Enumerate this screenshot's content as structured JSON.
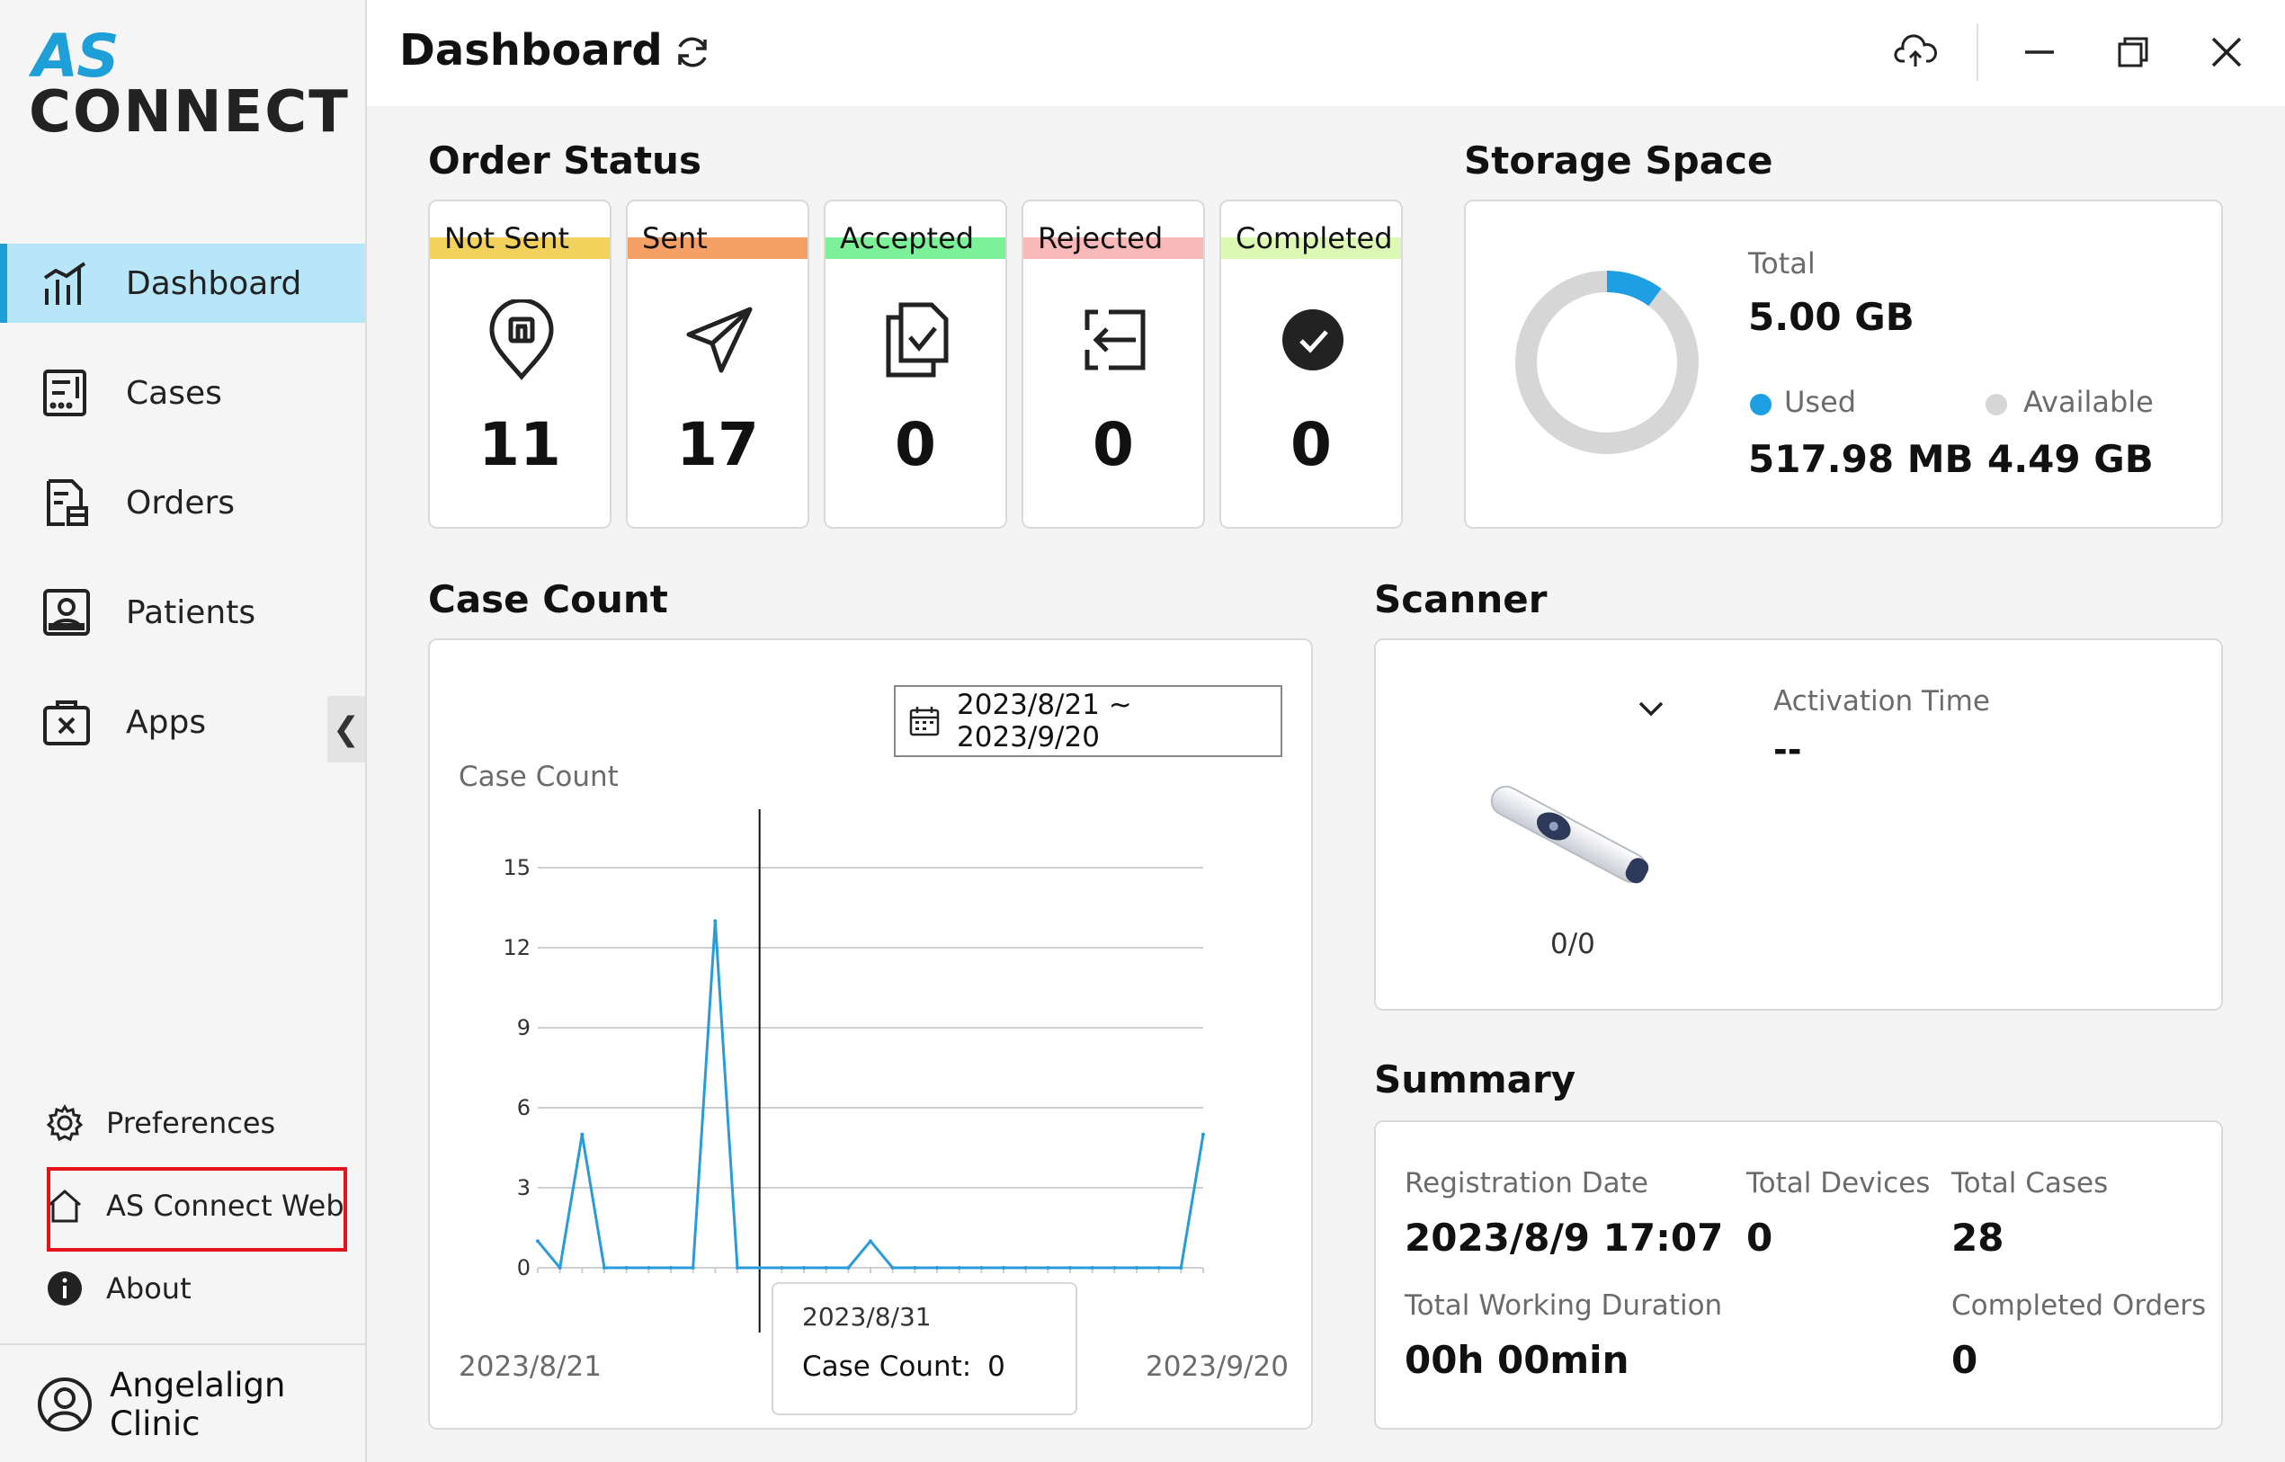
{
  "app": {
    "logo_top": "AS",
    "logo_bottom": "CONNECT"
  },
  "header": {
    "title": "Dashboard"
  },
  "sidebar": {
    "items": [
      {
        "label": "Dashboard",
        "icon": "dashboard-icon",
        "active": true
      },
      {
        "label": "Cases",
        "icon": "cases-icon"
      },
      {
        "label": "Orders",
        "icon": "orders-icon"
      },
      {
        "label": "Patients",
        "icon": "patients-icon"
      },
      {
        "label": "Apps",
        "icon": "apps-icon"
      }
    ],
    "preferences": "Preferences",
    "web": "AS Connect Web",
    "about": "About",
    "user": "Angelalign Clinic",
    "collapse_glyph": "❮"
  },
  "order_status": {
    "title": "Order Status",
    "cards": [
      {
        "label": "Not Sent",
        "value": "11",
        "color": "#f2d15c",
        "icon": "location-pin-icon"
      },
      {
        "label": "Sent",
        "value": "17",
        "color": "#f5a066",
        "icon": "send-icon"
      },
      {
        "label": "Accepted",
        "value": "0",
        "color": "#7df09a",
        "icon": "document-check-icon"
      },
      {
        "label": "Rejected",
        "value": "0",
        "color": "#f9b9b9",
        "icon": "return-icon"
      },
      {
        "label": "Completed",
        "value": "0",
        "color": "#ddf8b4",
        "icon": "check-circle-icon"
      }
    ]
  },
  "storage": {
    "title": "Storage Space",
    "total_label": "Total",
    "total_value": "5.00 GB",
    "used_label": "Used",
    "used_value": "517.98 MB",
    "available_label": "Available",
    "available_value": "4.49 GB",
    "used_fraction": 0.1012,
    "used_color": "#1e9fe3",
    "available_color": "#d6d6d6"
  },
  "case_count": {
    "title": "Case Count",
    "chart_title": "Case Count",
    "date_range": "2023/8/21 ~ 2023/9/20",
    "x_start": "2023/8/21",
    "x_end": "2023/9/20",
    "tooltip_date": "2023/8/31",
    "tooltip_label": "Case Count:",
    "tooltip_value": "0"
  },
  "chart_data": {
    "type": "line",
    "title": "Case Count",
    "xlabel": "",
    "ylabel": "",
    "x_range": [
      "2023/8/21",
      "2023/9/20"
    ],
    "ylim": [
      0,
      15
    ],
    "yticks": [
      0,
      3,
      6,
      9,
      12,
      15
    ],
    "grid": true,
    "line_color": "#2b9bd8",
    "series": [
      {
        "x": [
          "2023/8/21",
          "2023/8/22",
          "2023/8/23",
          "2023/8/24",
          "2023/8/25",
          "2023/8/26",
          "2023/8/27",
          "2023/8/28",
          "2023/8/29",
          "2023/8/30",
          "2023/8/31",
          "2023/9/1",
          "2023/9/2",
          "2023/9/3",
          "2023/9/4",
          "2023/9/5",
          "2023/9/6",
          "2023/9/7",
          "2023/9/8",
          "2023/9/9",
          "2023/9/10",
          "2023/9/11",
          "2023/9/12",
          "2023/9/13",
          "2023/9/14",
          "2023/9/15",
          "2023/9/16",
          "2023/9/17",
          "2023/9/18",
          "2023/9/19",
          "2023/9/20"
        ],
        "values": [
          1,
          0,
          5,
          0,
          0,
          0,
          0,
          0,
          13,
          0,
          0,
          0,
          0,
          0,
          0,
          1,
          0,
          0,
          0,
          0,
          0,
          0,
          0,
          0,
          0,
          0,
          0,
          0,
          0,
          0,
          5
        ]
      }
    ],
    "highlight": {
      "x": "2023/8/31",
      "value": 0
    }
  },
  "scanner": {
    "title": "Scanner",
    "activation_label": "Activation Time",
    "activation_value": "--",
    "count": "0/0"
  },
  "summary": {
    "title": "Summary",
    "registration_label": "Registration Date",
    "registration_value": "2023/8/9 17:07",
    "devices_label": "Total Devices",
    "devices_value": "0",
    "cases_label": "Total Cases",
    "cases_value": "28",
    "duration_label": "Total Working Duration",
    "duration_value": "00h 00min",
    "completed_label": "Completed Orders",
    "completed_value": "0"
  }
}
